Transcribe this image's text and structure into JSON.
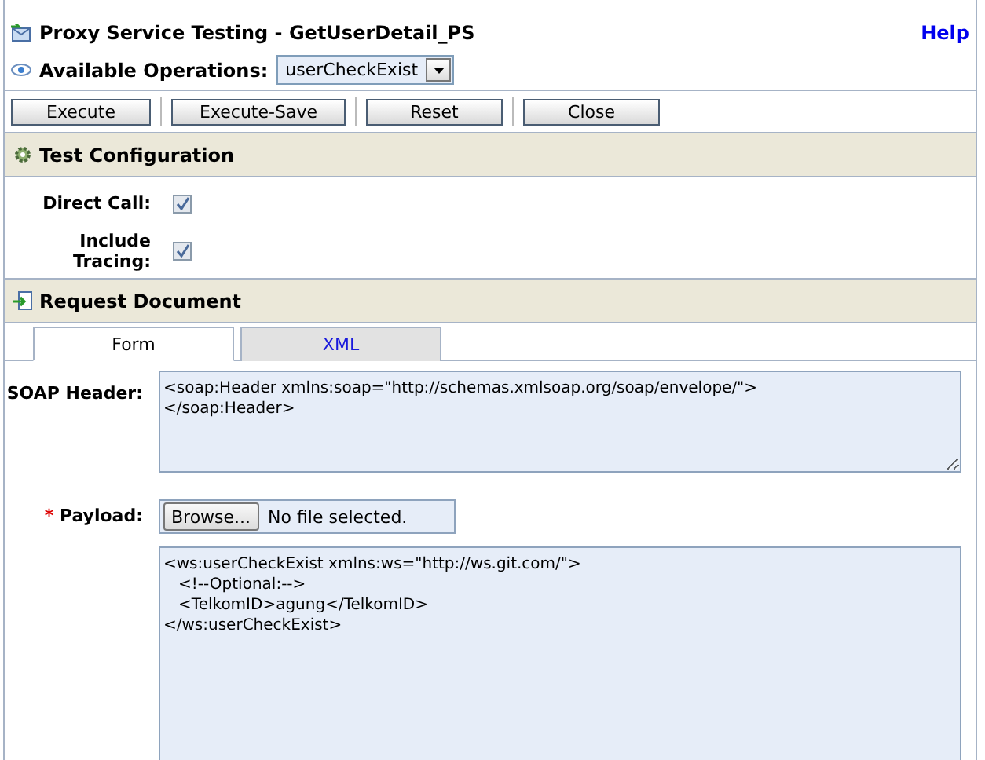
{
  "window": {
    "title": "Proxy Service Testing - GetUserDetail_PS",
    "help_link": "Help"
  },
  "operations": {
    "label": "Available Operations:",
    "value": "userCheckExist"
  },
  "buttons": [
    "Execute",
    "Execute-Save",
    "Reset",
    "Close"
  ],
  "test_configuration": {
    "title": "Test Configuration",
    "options": [
      {
        "label": "Direct Call:",
        "checked": true
      },
      {
        "label": "Include Tracing:",
        "checked": true
      }
    ]
  },
  "request_document": {
    "title": "Request Document",
    "tabs": [
      {
        "label": "Form",
        "selected": true
      },
      {
        "label": "XML",
        "selected": false
      }
    ],
    "soap_header": {
      "label": "SOAP Header:",
      "value": [
        "<soap:Header xmlns:soap=\"http://schemas.xmlsoap.org/soap/envelope/\">",
        "</soap:Header>"
      ]
    },
    "payload": {
      "required_mark": "*",
      "label": "Payload:",
      "browse_button": "Browse...",
      "file_status": "No file selected.",
      "value": [
        "<ws:userCheckExist xmlns:ws=\"http://ws.git.com/\">",
        "   <!--Optional:-->",
        "   <TelkomID>agung</TelkomID>",
        "</ws:userCheckExist>"
      ]
    }
  }
}
